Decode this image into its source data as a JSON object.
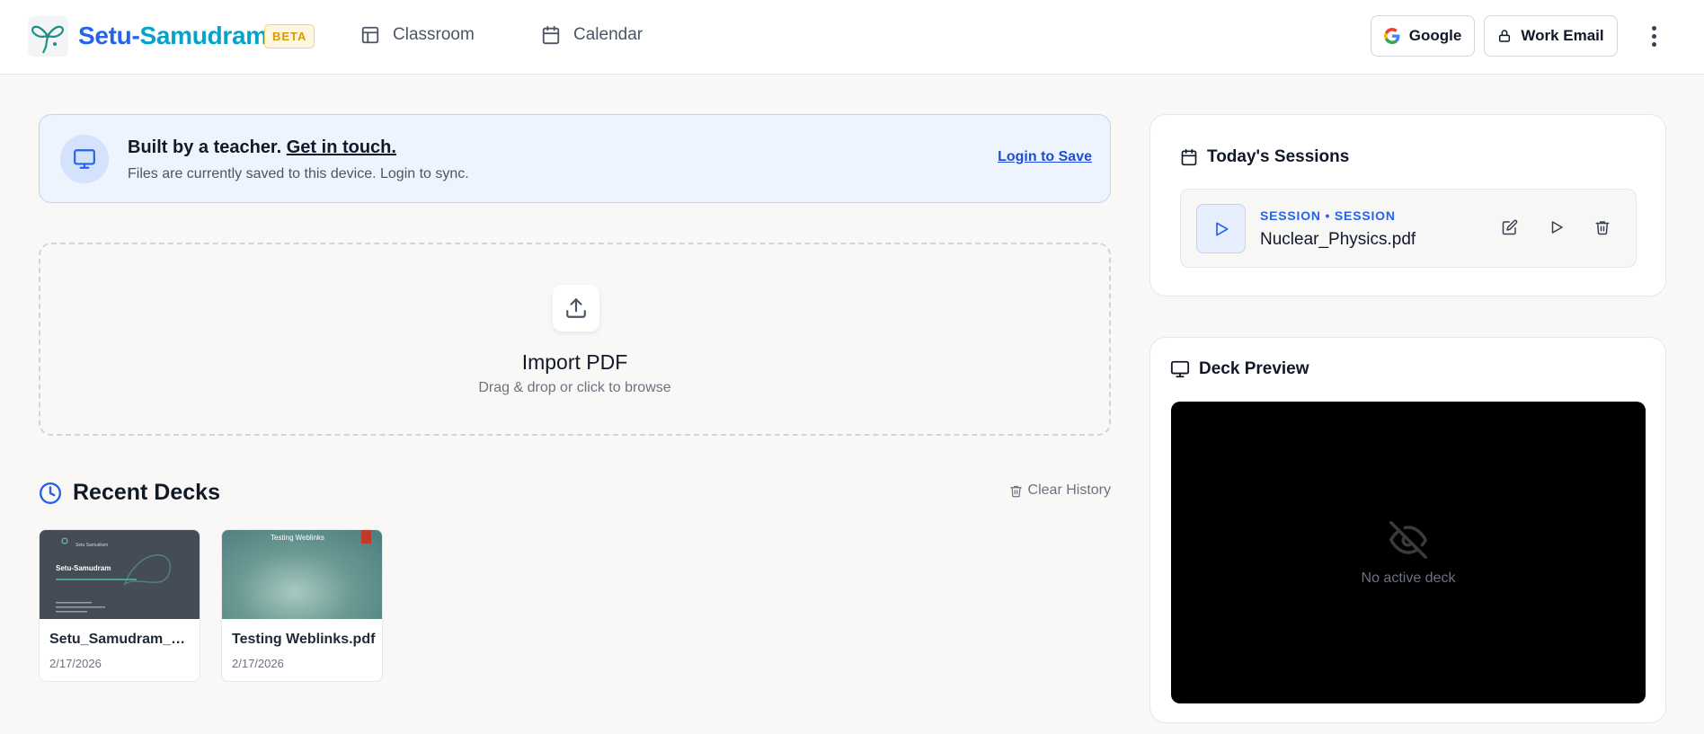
{
  "header": {
    "brand_part1": "Setu-",
    "brand_part2": "Samudram",
    "badge": "BETA",
    "nav": [
      {
        "label": "Classroom",
        "icon": "layout-icon"
      },
      {
        "label": "Calendar",
        "icon": "calendar-icon"
      }
    ],
    "google_label": "Google",
    "work_email_label": "Work Email"
  },
  "banner": {
    "title": "Built by a teacher.",
    "title_link": "Get in touch.",
    "subtitle": "Files are currently saved to this device. Login to sync.",
    "login_label": "Login to Save"
  },
  "import": {
    "title": "Import PDF",
    "subtitle": "Drag & drop or click to browse"
  },
  "recent": {
    "title": "Recent Decks",
    "clear_label": "Clear History",
    "decks": [
      {
        "name": "Setu_Samudram_B...",
        "date": "2/17/2026",
        "thumb_title": "Setu-Samudram"
      },
      {
        "name": "Testing Weblinks.pdf",
        "date": "2/17/2026",
        "thumb_title": "Testing Weblinks"
      }
    ]
  },
  "sessions": {
    "title": "Today's Sessions",
    "items": [
      {
        "label": "SESSION • SESSION",
        "file": "Nuclear_Physics.pdf"
      }
    ]
  },
  "preview": {
    "title": "Deck Preview",
    "empty_text": "No active deck"
  },
  "colors": {
    "accent": "#2563eb",
    "brand_secondary": "#06a3c8",
    "beta_badge": "#d49a0a",
    "banner_bg": "#eef4fe"
  }
}
